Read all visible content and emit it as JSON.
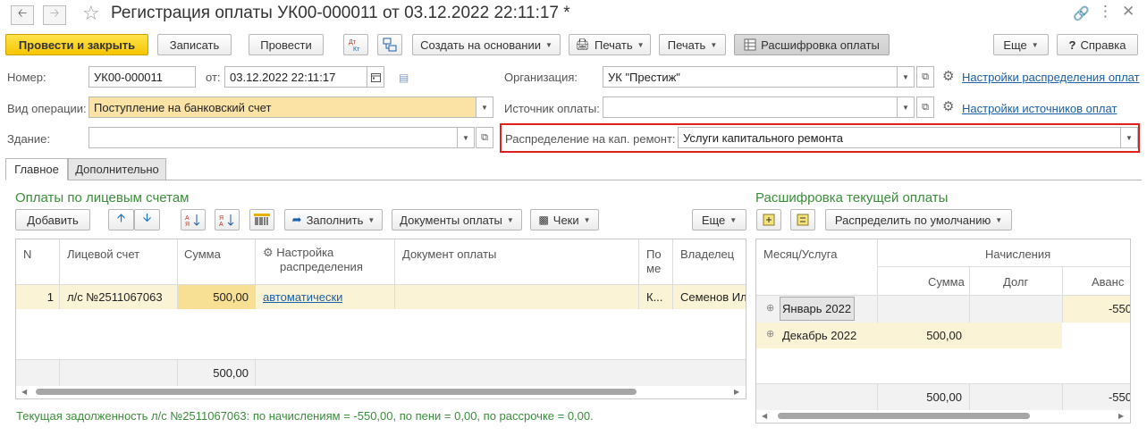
{
  "window": {
    "title": "Регистрация оплаты УК00-000011 от 03.12.2022 22:11:17 *",
    "back_icon": "arrow-left",
    "forward_icon": "arrow-right",
    "favorite_icon": "star"
  },
  "toolbar": {
    "post_close": "Провести и закрыть",
    "save": "Записать",
    "post": "Провести",
    "dt_kt": "Дт Кт",
    "create_based": "Создать на основании",
    "print1": "Печать",
    "print2": "Печать",
    "decode": "Расшифровка оплаты",
    "more": "Еще",
    "help": "Справка",
    "help_mark": "?"
  },
  "form": {
    "number_label": "Номер:",
    "number_value": "УК00-000011",
    "from_label": "от:",
    "date_value": "03.12.2022 22:11:17",
    "org_label": "Организация:",
    "org_value": "УК \"Престиж\"",
    "org_settings_link": "Настройки распределения оплат",
    "op_type_label": "Вид операции:",
    "op_type_value": "Поступление на банковский счет",
    "source_label": "Источник оплаты:",
    "source_value": "",
    "source_settings_link": "Настройки источников оплат",
    "building_label": "Здание:",
    "building_value": "",
    "repair_label": "Распределение на кап. ремонт:",
    "repair_value": "Услуги капитального ремонта",
    "highlight_color": "#e0201b"
  },
  "tabs": [
    {
      "label": "Главное",
      "active": true
    },
    {
      "label": "Дополнительно",
      "active": false
    }
  ],
  "payments": {
    "title": "Оплаты по лицевым счетам",
    "add_button": "Добавить",
    "fill_button": "Заполнить",
    "docs_button": "Документы оплаты",
    "checks_button": "Чеки",
    "more_button": "Еще",
    "columns": {
      "n": "N",
      "account": "Лицевой счет",
      "sum": "Сумма",
      "settings_line1": "Настройка",
      "settings_line2": "распределения",
      "doc": "Документ оплаты",
      "po_line1": "По",
      "po_line2": "ме",
      "owner": "Владелец"
    },
    "rows": [
      {
        "n": "1",
        "account": "л/с №2511067063",
        "sum": "500,00",
        "settings": "автоматически",
        "doc": "",
        "po": "К...",
        "owner": "Семенов Ил"
      }
    ],
    "total_sum": "500,00"
  },
  "decode": {
    "title": "Расшифровка текущей оплаты",
    "distribute_button": "Распределить по умолчанию",
    "columns": {
      "month": "Месяц/Услуга",
      "accruals": "Начисления",
      "sum": "Сумма",
      "debt": "Долг",
      "advance": "Аванс"
    },
    "rows": [
      {
        "month": "Январь 2022",
        "sum": "",
        "debt": "",
        "advance": "-550"
      },
      {
        "month": "Декабрь 2022",
        "sum": "500,00",
        "debt": "",
        "advance": ""
      }
    ],
    "total_sum": "500,00",
    "total_advance": "-550"
  },
  "status": {
    "text": "Текущая задолженность л/с №2511067063: по начислениям = -550,00, по пени = 0,00, по рассрочке = 0,00."
  }
}
